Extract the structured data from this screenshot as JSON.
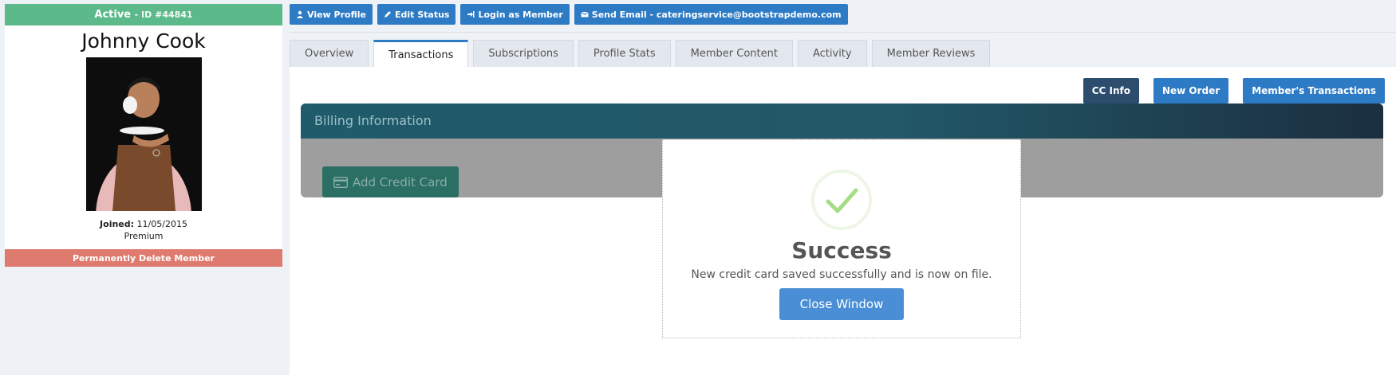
{
  "member": {
    "status": "Active",
    "id_label": "- ID #44841",
    "name": "Johnny Cook",
    "joined_label": "Joined:",
    "joined_date": "11/05/2015",
    "plan": "Premium",
    "delete_label": "Permanently Delete Member"
  },
  "actions": {
    "view_profile": "View Profile",
    "edit_status": "Edit Status",
    "login_as_member": "Login as Member",
    "send_email": "Send Email - cateringservice@bootstrapdemo.com"
  },
  "tabs": [
    {
      "label": "Overview"
    },
    {
      "label": "Transactions"
    },
    {
      "label": "Subscriptions"
    },
    {
      "label": "Profile Stats"
    },
    {
      "label": "Member Content"
    },
    {
      "label": "Activity"
    },
    {
      "label": "Member Reviews"
    }
  ],
  "panel": {
    "cc_info": "CC Info",
    "new_order": "New Order",
    "members_transactions": "Member's Transactions",
    "billing_title": "Billing Information",
    "add_credit_card": "Add Credit Card"
  },
  "modal": {
    "title": "Success",
    "message": "New credit card saved successfully and is now on file.",
    "close_label": "Close Window"
  },
  "colors": {
    "status_green": "#5cb98a",
    "primary_blue": "#2e7bc5",
    "danger_red": "#df7a6e",
    "success_check": "#a5dc86"
  }
}
